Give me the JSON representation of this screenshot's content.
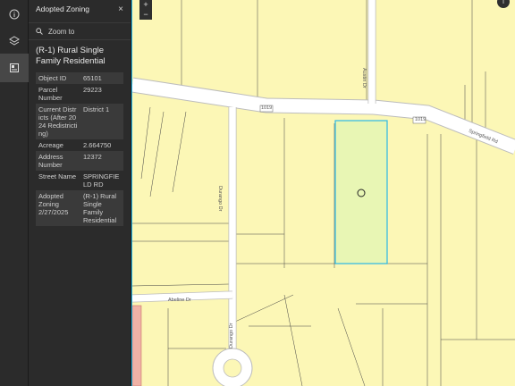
{
  "sidebar": {
    "buttons": [
      {
        "name": "info-button",
        "icon": "info-icon"
      },
      {
        "name": "layers-button",
        "icon": "layers-icon"
      },
      {
        "name": "adopted-zoning-button",
        "icon": "map-legend-icon"
      }
    ]
  },
  "panel": {
    "title": "Adopted Zoning",
    "close_label": "×",
    "zoom_label": "Zoom to",
    "feature_title": "(R-1) Rural Single Family Residential",
    "attributes": [
      {
        "key": "Object ID",
        "value": "65101"
      },
      {
        "key": "Parcel Number",
        "value": "29223"
      },
      {
        "key": "Current Districts (After 2024 Redistricting)",
        "value": "District 1"
      },
      {
        "key": "Acreage",
        "value": "2.664750"
      },
      {
        "key": "Address Number",
        "value": "12372"
      },
      {
        "key": "Street Name",
        "value": "SPRINGFIELD RD"
      },
      {
        "key": "Adopted Zoning 2/27/2025",
        "value": "(R-1) Rural Single Family Residential"
      }
    ]
  },
  "map": {
    "zoom_in": "+",
    "zoom_out": "−",
    "info": "i",
    "labels": {
      "austin": "Austin Dr",
      "road_1019_a": "1019",
      "road_1019_b": "1019",
      "springfield": "Springfield Rd",
      "durango": "Durango Dr",
      "abeline": "Abeline Dr",
      "bottom_street": "Durango Dr"
    },
    "colors": {
      "parcel": "#fcf7b6",
      "selected": "#e8f6b4",
      "selection_outline": "#2bb8e6"
    }
  }
}
